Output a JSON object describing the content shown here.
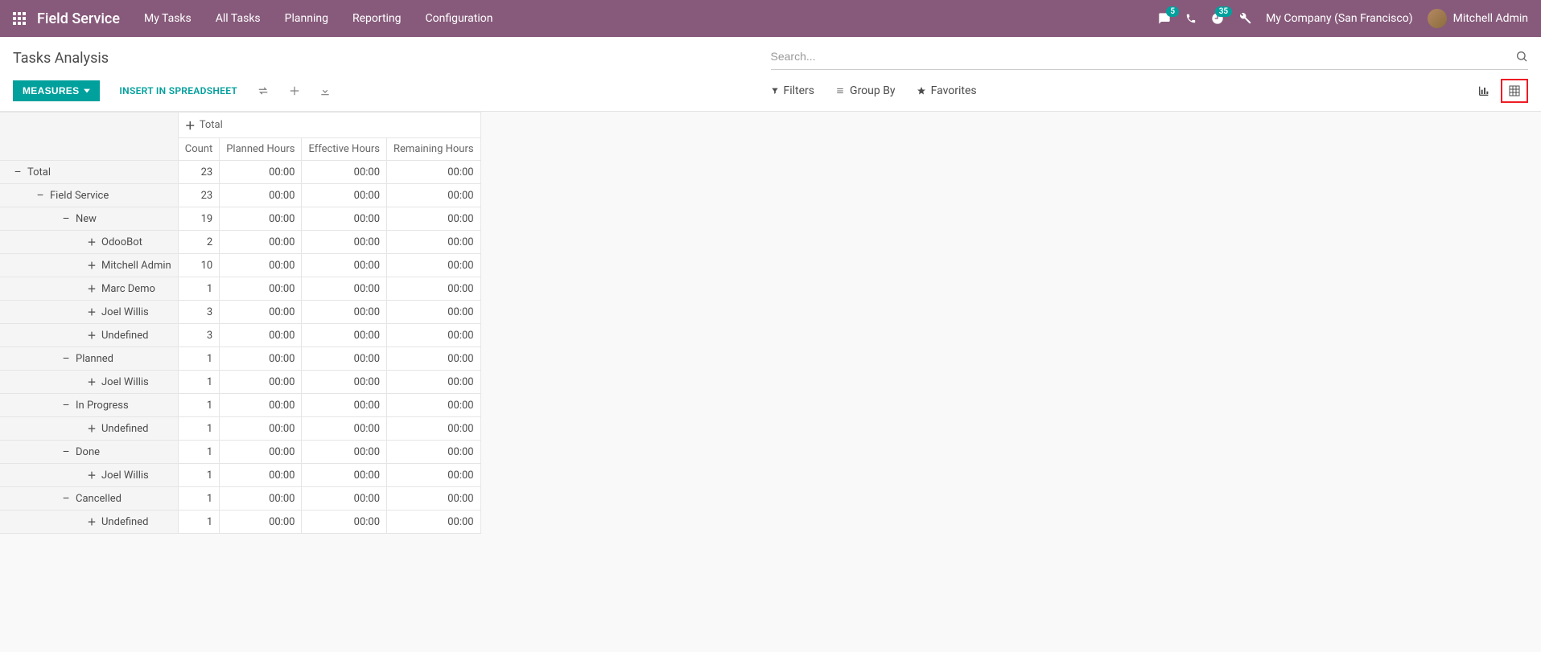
{
  "navbar": {
    "brand": "Field Service",
    "menu": [
      "My Tasks",
      "All Tasks",
      "Planning",
      "Reporting",
      "Configuration"
    ],
    "message_badge": "5",
    "activity_badge": "35",
    "company": "My Company (San Francisco)",
    "user": "Mitchell Admin"
  },
  "cp": {
    "title": "Tasks Analysis",
    "search_placeholder": "Search...",
    "measures_label": "MEASURES",
    "insert_label": "INSERT IN SPREADSHEET",
    "filters_label": "Filters",
    "groupby_label": "Group By",
    "favorites_label": "Favorites"
  },
  "pivot": {
    "col_header_total": "Total",
    "measures": [
      "Count",
      "Planned Hours",
      "Effective Hours",
      "Remaining Hours"
    ],
    "rows": [
      {
        "indent": 0,
        "icon": "minus",
        "label": "Total",
        "values": [
          "23",
          "00:00",
          "00:00",
          "00:00"
        ]
      },
      {
        "indent": 1,
        "icon": "minus",
        "label": "Field Service",
        "values": [
          "23",
          "00:00",
          "00:00",
          "00:00"
        ]
      },
      {
        "indent": 2,
        "icon": "minus",
        "label": "New",
        "values": [
          "19",
          "00:00",
          "00:00",
          "00:00"
        ]
      },
      {
        "indent": 3,
        "icon": "plus",
        "label": "OdooBot",
        "values": [
          "2",
          "00:00",
          "00:00",
          "00:00"
        ]
      },
      {
        "indent": 3,
        "icon": "plus",
        "label": "Mitchell Admin",
        "values": [
          "10",
          "00:00",
          "00:00",
          "00:00"
        ]
      },
      {
        "indent": 3,
        "icon": "plus",
        "label": "Marc Demo",
        "values": [
          "1",
          "00:00",
          "00:00",
          "00:00"
        ]
      },
      {
        "indent": 3,
        "icon": "plus",
        "label": "Joel Willis",
        "values": [
          "3",
          "00:00",
          "00:00",
          "00:00"
        ]
      },
      {
        "indent": 3,
        "icon": "plus",
        "label": "Undefined",
        "values": [
          "3",
          "00:00",
          "00:00",
          "00:00"
        ]
      },
      {
        "indent": 2,
        "icon": "minus",
        "label": "Planned",
        "values": [
          "1",
          "00:00",
          "00:00",
          "00:00"
        ]
      },
      {
        "indent": 3,
        "icon": "plus",
        "label": "Joel Willis",
        "values": [
          "1",
          "00:00",
          "00:00",
          "00:00"
        ]
      },
      {
        "indent": 2,
        "icon": "minus",
        "label": "In Progress",
        "values": [
          "1",
          "00:00",
          "00:00",
          "00:00"
        ]
      },
      {
        "indent": 3,
        "icon": "plus",
        "label": "Undefined",
        "values": [
          "1",
          "00:00",
          "00:00",
          "00:00"
        ]
      },
      {
        "indent": 2,
        "icon": "minus",
        "label": "Done",
        "values": [
          "1",
          "00:00",
          "00:00",
          "00:00"
        ]
      },
      {
        "indent": 3,
        "icon": "plus",
        "label": "Joel Willis",
        "values": [
          "1",
          "00:00",
          "00:00",
          "00:00"
        ]
      },
      {
        "indent": 2,
        "icon": "minus",
        "label": "Cancelled",
        "values": [
          "1",
          "00:00",
          "00:00",
          "00:00"
        ]
      },
      {
        "indent": 3,
        "icon": "plus",
        "label": "Undefined",
        "values": [
          "1",
          "00:00",
          "00:00",
          "00:00"
        ]
      }
    ]
  }
}
